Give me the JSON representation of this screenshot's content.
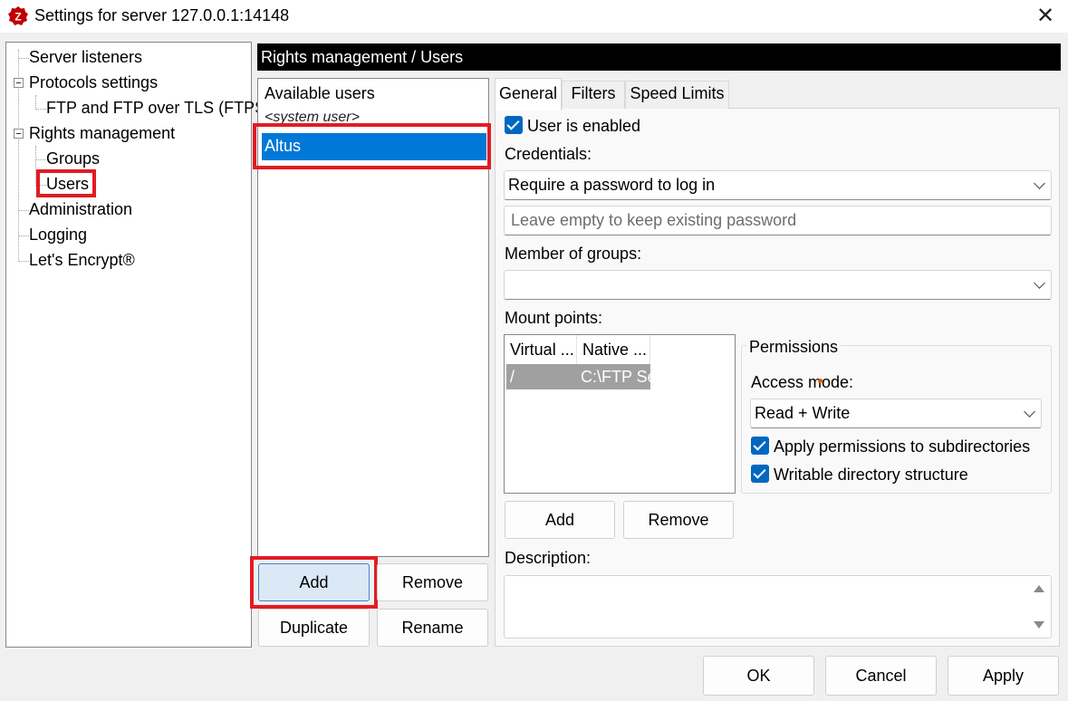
{
  "window": {
    "title": "Settings for server 127.0.0.1:14148",
    "close_glyph": "✕",
    "icon": "filezilla-server-icon"
  },
  "tree": {
    "items": [
      {
        "label": "Server listeners"
      },
      {
        "label": "Protocols settings"
      },
      {
        "label": "FTP and FTP over TLS (FTPS)"
      },
      {
        "label": "Rights management"
      },
      {
        "label": "Groups"
      },
      {
        "label": "Users"
      },
      {
        "label": "Administration"
      },
      {
        "label": "Logging"
      },
      {
        "label": "Let's Encrypt®"
      }
    ]
  },
  "header": {
    "title": "Rights management / Users"
  },
  "users": {
    "header": "Available users",
    "items": [
      {
        "label": "<system user>"
      },
      {
        "label": "Altus",
        "selected": true
      }
    ],
    "buttons": {
      "add": "Add",
      "remove": "Remove",
      "duplicate": "Duplicate",
      "rename": "Rename"
    }
  },
  "tabs": [
    {
      "label": "General",
      "active": true
    },
    {
      "label": "Filters",
      "active": false
    },
    {
      "label": "Speed Limits",
      "active": false
    }
  ],
  "general": {
    "user_enabled": {
      "label": "User is enabled",
      "checked": true
    },
    "credentials": {
      "label": "Credentials:",
      "value": "Require a password to log in",
      "password_placeholder": "Leave empty to keep existing password"
    },
    "member_of_groups": {
      "label": "Member of groups:",
      "value": ""
    },
    "mount_points": {
      "label": "Mount points:",
      "columns": [
        "Virtual ...",
        "Native ..."
      ],
      "rows": [
        [
          "/",
          "C:\\FTP Ser"
        ]
      ],
      "add_button": "Add",
      "remove_button": "Remove"
    },
    "permissions": {
      "title": "Permissions",
      "access_mode_label": "Access mode:",
      "access_mode_value": "Read + Write",
      "apply_subdirs": {
        "label": "Apply permissions to subdirectories",
        "checked": true
      },
      "writable_structure": {
        "label": "Writable directory structure",
        "checked": true
      }
    },
    "description": {
      "label": "Description:",
      "value": ""
    }
  },
  "footer": {
    "ok": "OK",
    "cancel": "Cancel",
    "apply": "Apply"
  },
  "colors": {
    "highlight": "#e21b23",
    "selection": "#0078d7",
    "checkbox": "#0067c0"
  }
}
